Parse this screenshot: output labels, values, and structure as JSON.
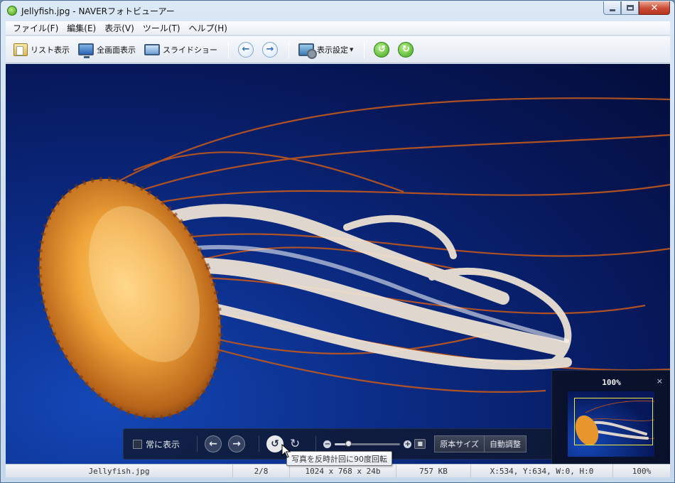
{
  "window": {
    "title": "Jellyfish.jpg - NAVERフォトビューアー",
    "min_glyph": "",
    "max_glyph": "",
    "close_glyph": "✕"
  },
  "menu": [
    "ファイル(F)",
    "編集(E)",
    "表示(V)",
    "ツール(T)",
    "ヘルプ(H)"
  ],
  "toolbar": {
    "list_view": "リスト表示",
    "fullscreen": "全画面表示",
    "slideshow": "スライドショー",
    "display_settings": "表示設定",
    "back_glyph": "←",
    "forward_glyph": "→",
    "rotate_left_glyph": "↺",
    "rotate_right_glyph": "↻"
  },
  "overlay": {
    "always_show": "常に表示",
    "prev_glyph": "←",
    "next_glyph": "→",
    "rotate_ccw_glyph": "↺",
    "rotate_cw_glyph": "↻",
    "zoom_out_glyph": "−",
    "zoom_in_glyph": "+",
    "zoom_fraction": 0.2,
    "actual_size": "原本サイズ",
    "auto_fit": "自動調整"
  },
  "tooltip": "写真を反時計回に90度回転",
  "navigator": {
    "zoom": "100%",
    "close_glyph": "×"
  },
  "status": {
    "filename": "Jellyfish.jpg",
    "index": "2/8",
    "dimensions": "1024 x 768 x 24b",
    "size": "757 KB",
    "coords": "X:534, Y:634, W:0, H:0",
    "zoom": "100%"
  },
  "colors": {
    "accent_green": "#3da51a",
    "accent_blue": "#2f6fb8",
    "navigator_frame": "#f0ea3a"
  }
}
